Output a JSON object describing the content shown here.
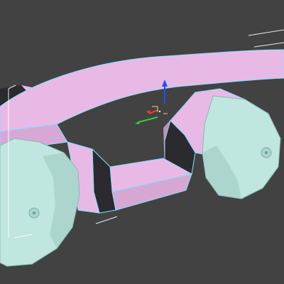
{
  "viewport": {
    "background_color": "#424242",
    "model_colors": {
      "body": "#e9b9e6",
      "body_shadow": "#2b2230",
      "body_dark": "#2a2a2f",
      "wheel": "#bfe6df",
      "wheel_shade": "#92c0b8",
      "selection_outline": "#7ee2ff",
      "bounding_box": "#ffffff"
    },
    "gizmo": {
      "x_axis_color": "#2fd13a",
      "y_axis_color": "#ff3b3b",
      "z_axis_color": "#1a4fff",
      "pivot_color": "#ffffff"
    }
  }
}
